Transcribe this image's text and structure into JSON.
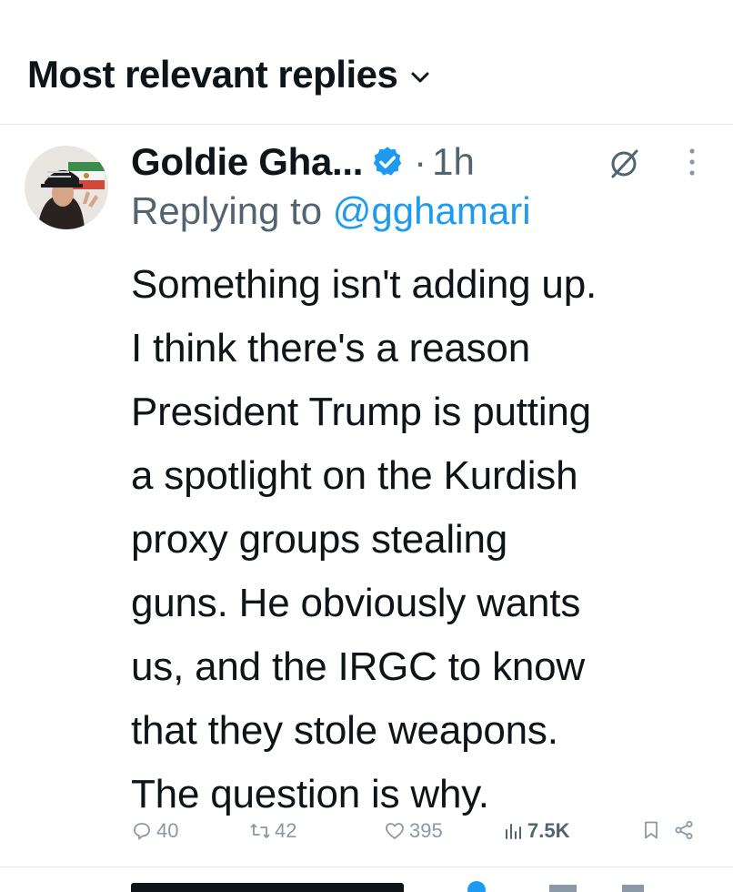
{
  "header": {
    "title": "Most relevant replies"
  },
  "tweet": {
    "author_name": "Goldie Gha...",
    "separator": "·",
    "time": "1h",
    "replying_prefix": "Replying to ",
    "replying_handle": "@gghamari",
    "lines": [
      "Something isn't adding up.",
      "I think there's a reason",
      "President Trump is putting",
      "a spotlight on the Kurdish",
      "proxy groups stealing",
      "guns. He obviously wants",
      "us, and the IRGC to know",
      "that they stole weapons.",
      "The question is why."
    ],
    "stats": {
      "replies": "40",
      "retweets": "42",
      "likes": "395",
      "views": "7.5K"
    },
    "icons": {
      "verified": "verified-badge-icon",
      "grok": "grok-icon",
      "more": "more-vertical-icon",
      "reply": "reply-icon",
      "retweet": "retweet-icon",
      "like": "heart-icon",
      "views": "views-icon",
      "bookmark": "bookmark-icon",
      "share": "share-icon"
    },
    "colors": {
      "verified": "#1d9bf0",
      "handle": "#1d9bf0",
      "muted": "#536471",
      "icon": "#8b98a5"
    }
  }
}
